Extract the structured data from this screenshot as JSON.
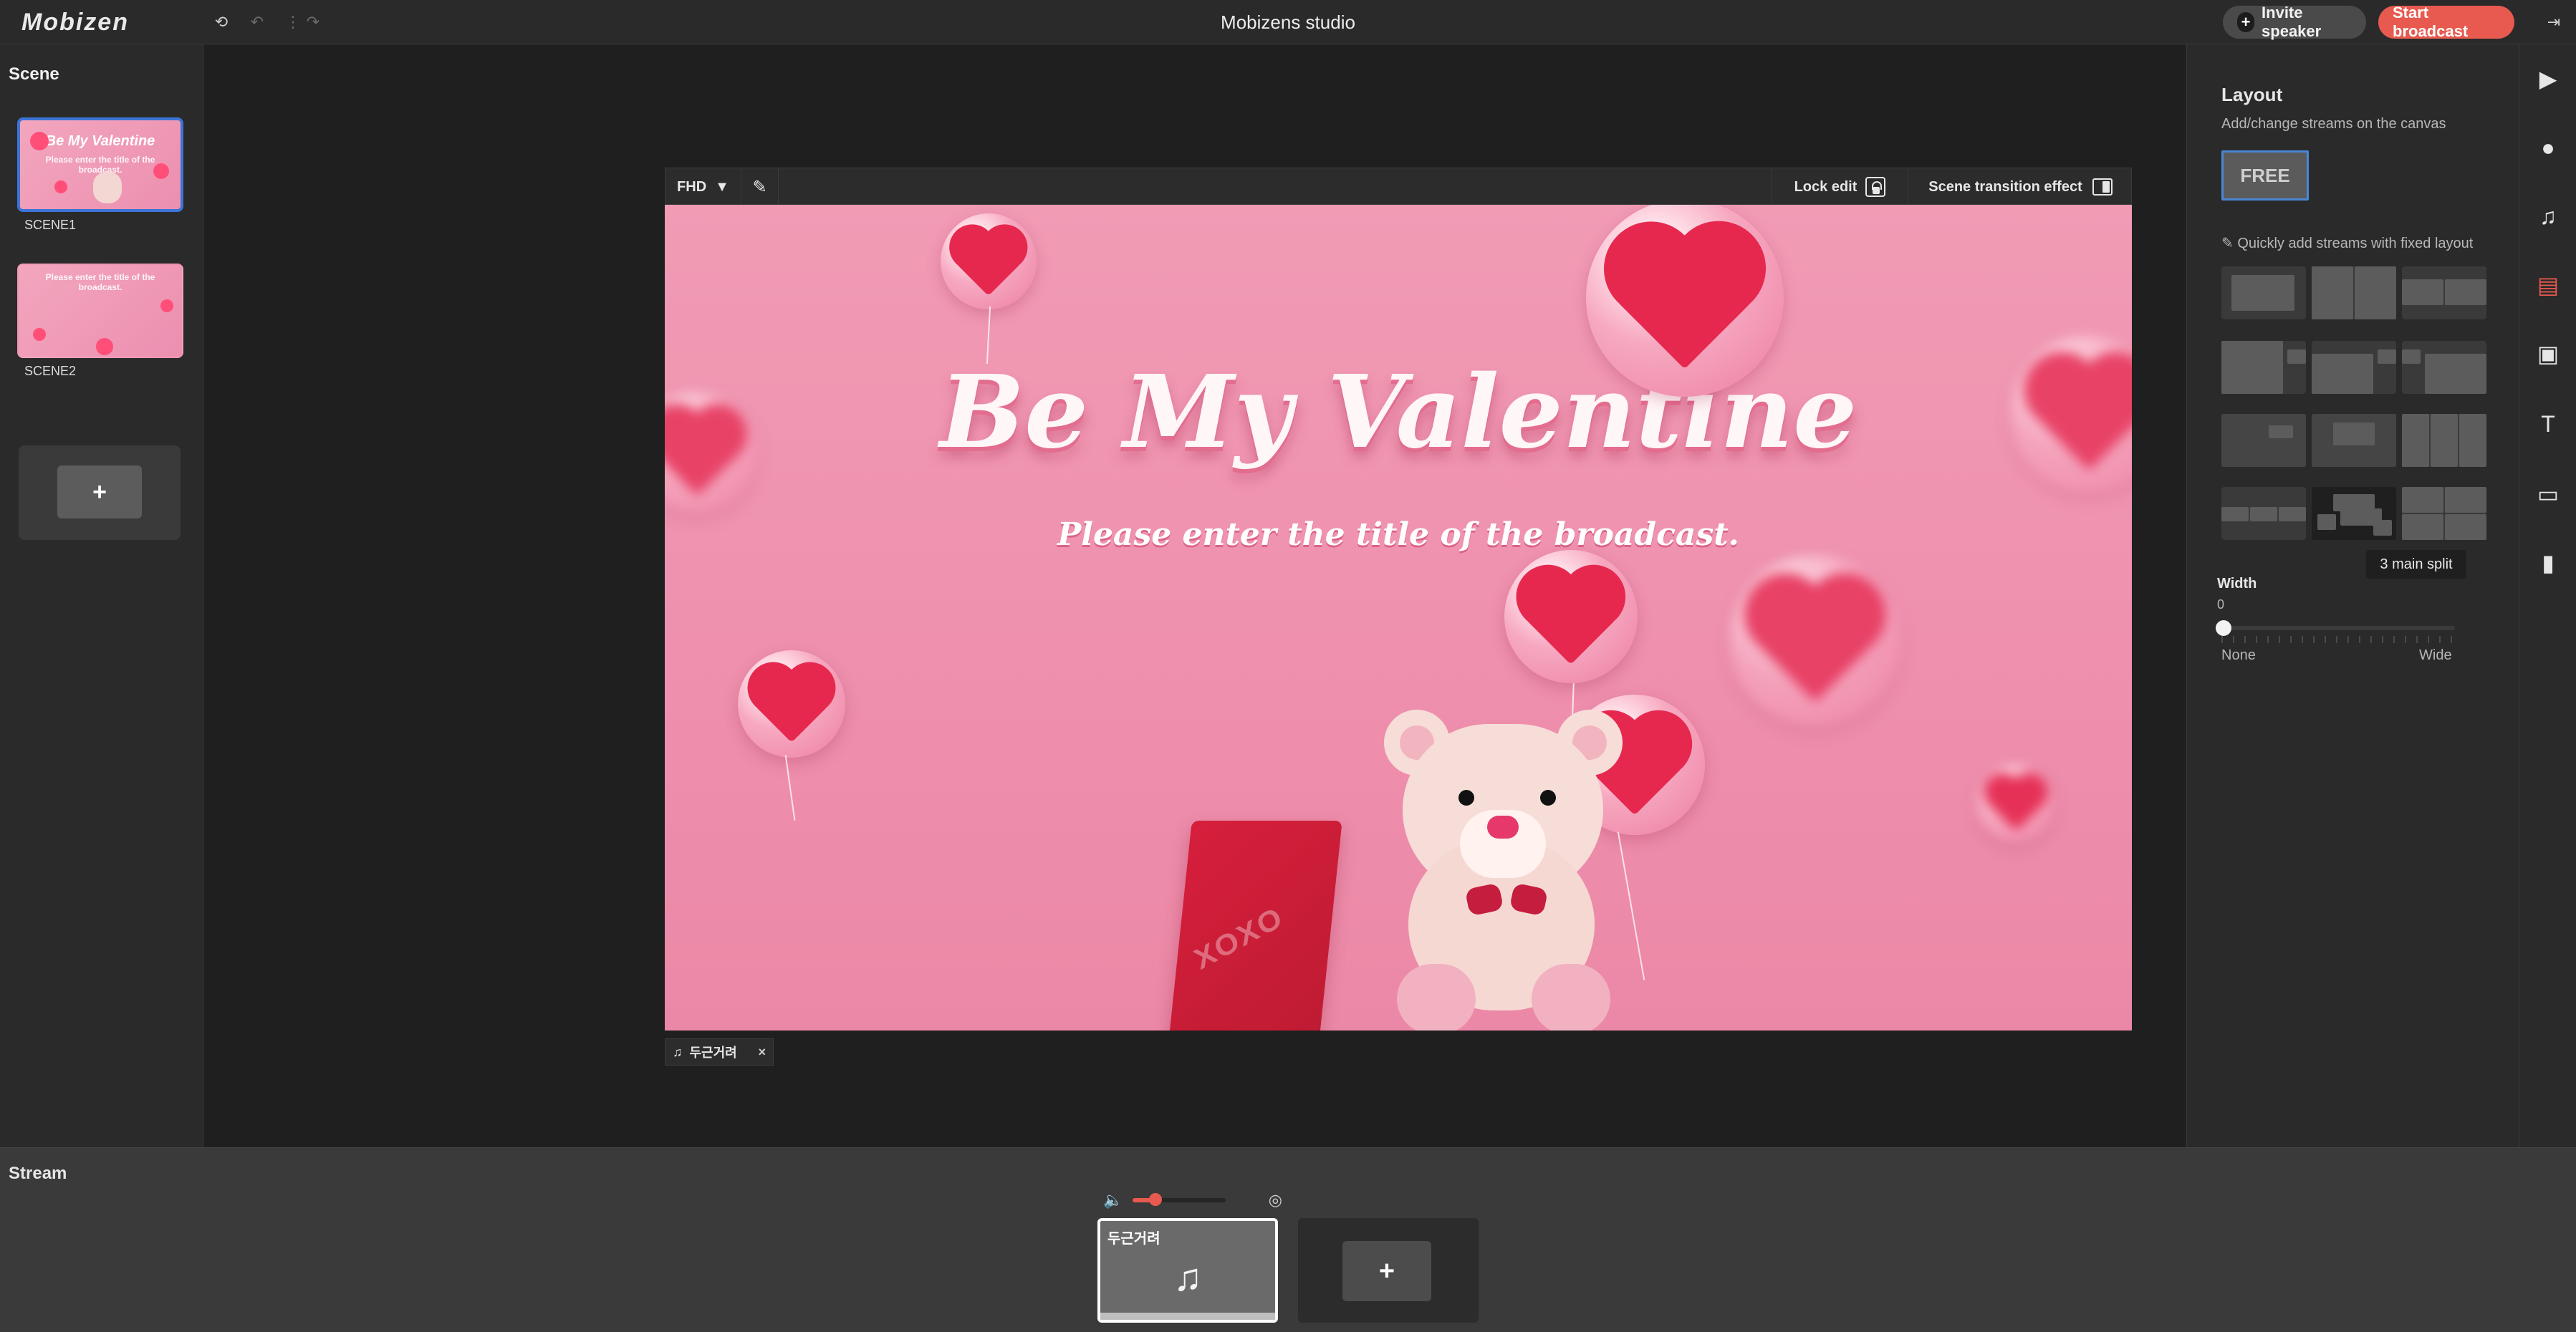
{
  "top": {
    "logo": "Mobizen",
    "title": "Mobizens studio",
    "invite_label": "Invite speaker",
    "start_label": "Start broadcast"
  },
  "scenes": {
    "header": "Scene",
    "items": [
      {
        "label": "SCENE1",
        "thumb_title": "Be My Valentine",
        "thumb_sub": "Please enter the title of the broadcast."
      },
      {
        "label": "SCENE2",
        "thumb_title": "",
        "thumb_sub": "Please enter the title of the broadcast."
      }
    ]
  },
  "canvas_toolbar": {
    "quality": "FHD",
    "lock_edit": "Lock edit",
    "scene_transition": "Scene transition effect"
  },
  "canvas": {
    "title": "Be My Valentine",
    "subtitle": "Please enter the title of the broadcast.",
    "bag_text": "XOXO"
  },
  "audio_chip": {
    "label": "두근거려"
  },
  "layout_panel": {
    "title": "Layout",
    "desc": "Add/change streams on the canvas",
    "free": "FREE",
    "quick": "Quickly add streams with fixed layout",
    "tooltip": "3 main split",
    "width_label": "Width",
    "width_value": "0",
    "none": "None",
    "wide": "Wide"
  },
  "stream_panel": {
    "header": "Stream",
    "volume": 0.24,
    "stream_name": "두근거려"
  },
  "colors": {
    "accent": "#e85a4f",
    "selection_blue": "#3c74d8"
  }
}
